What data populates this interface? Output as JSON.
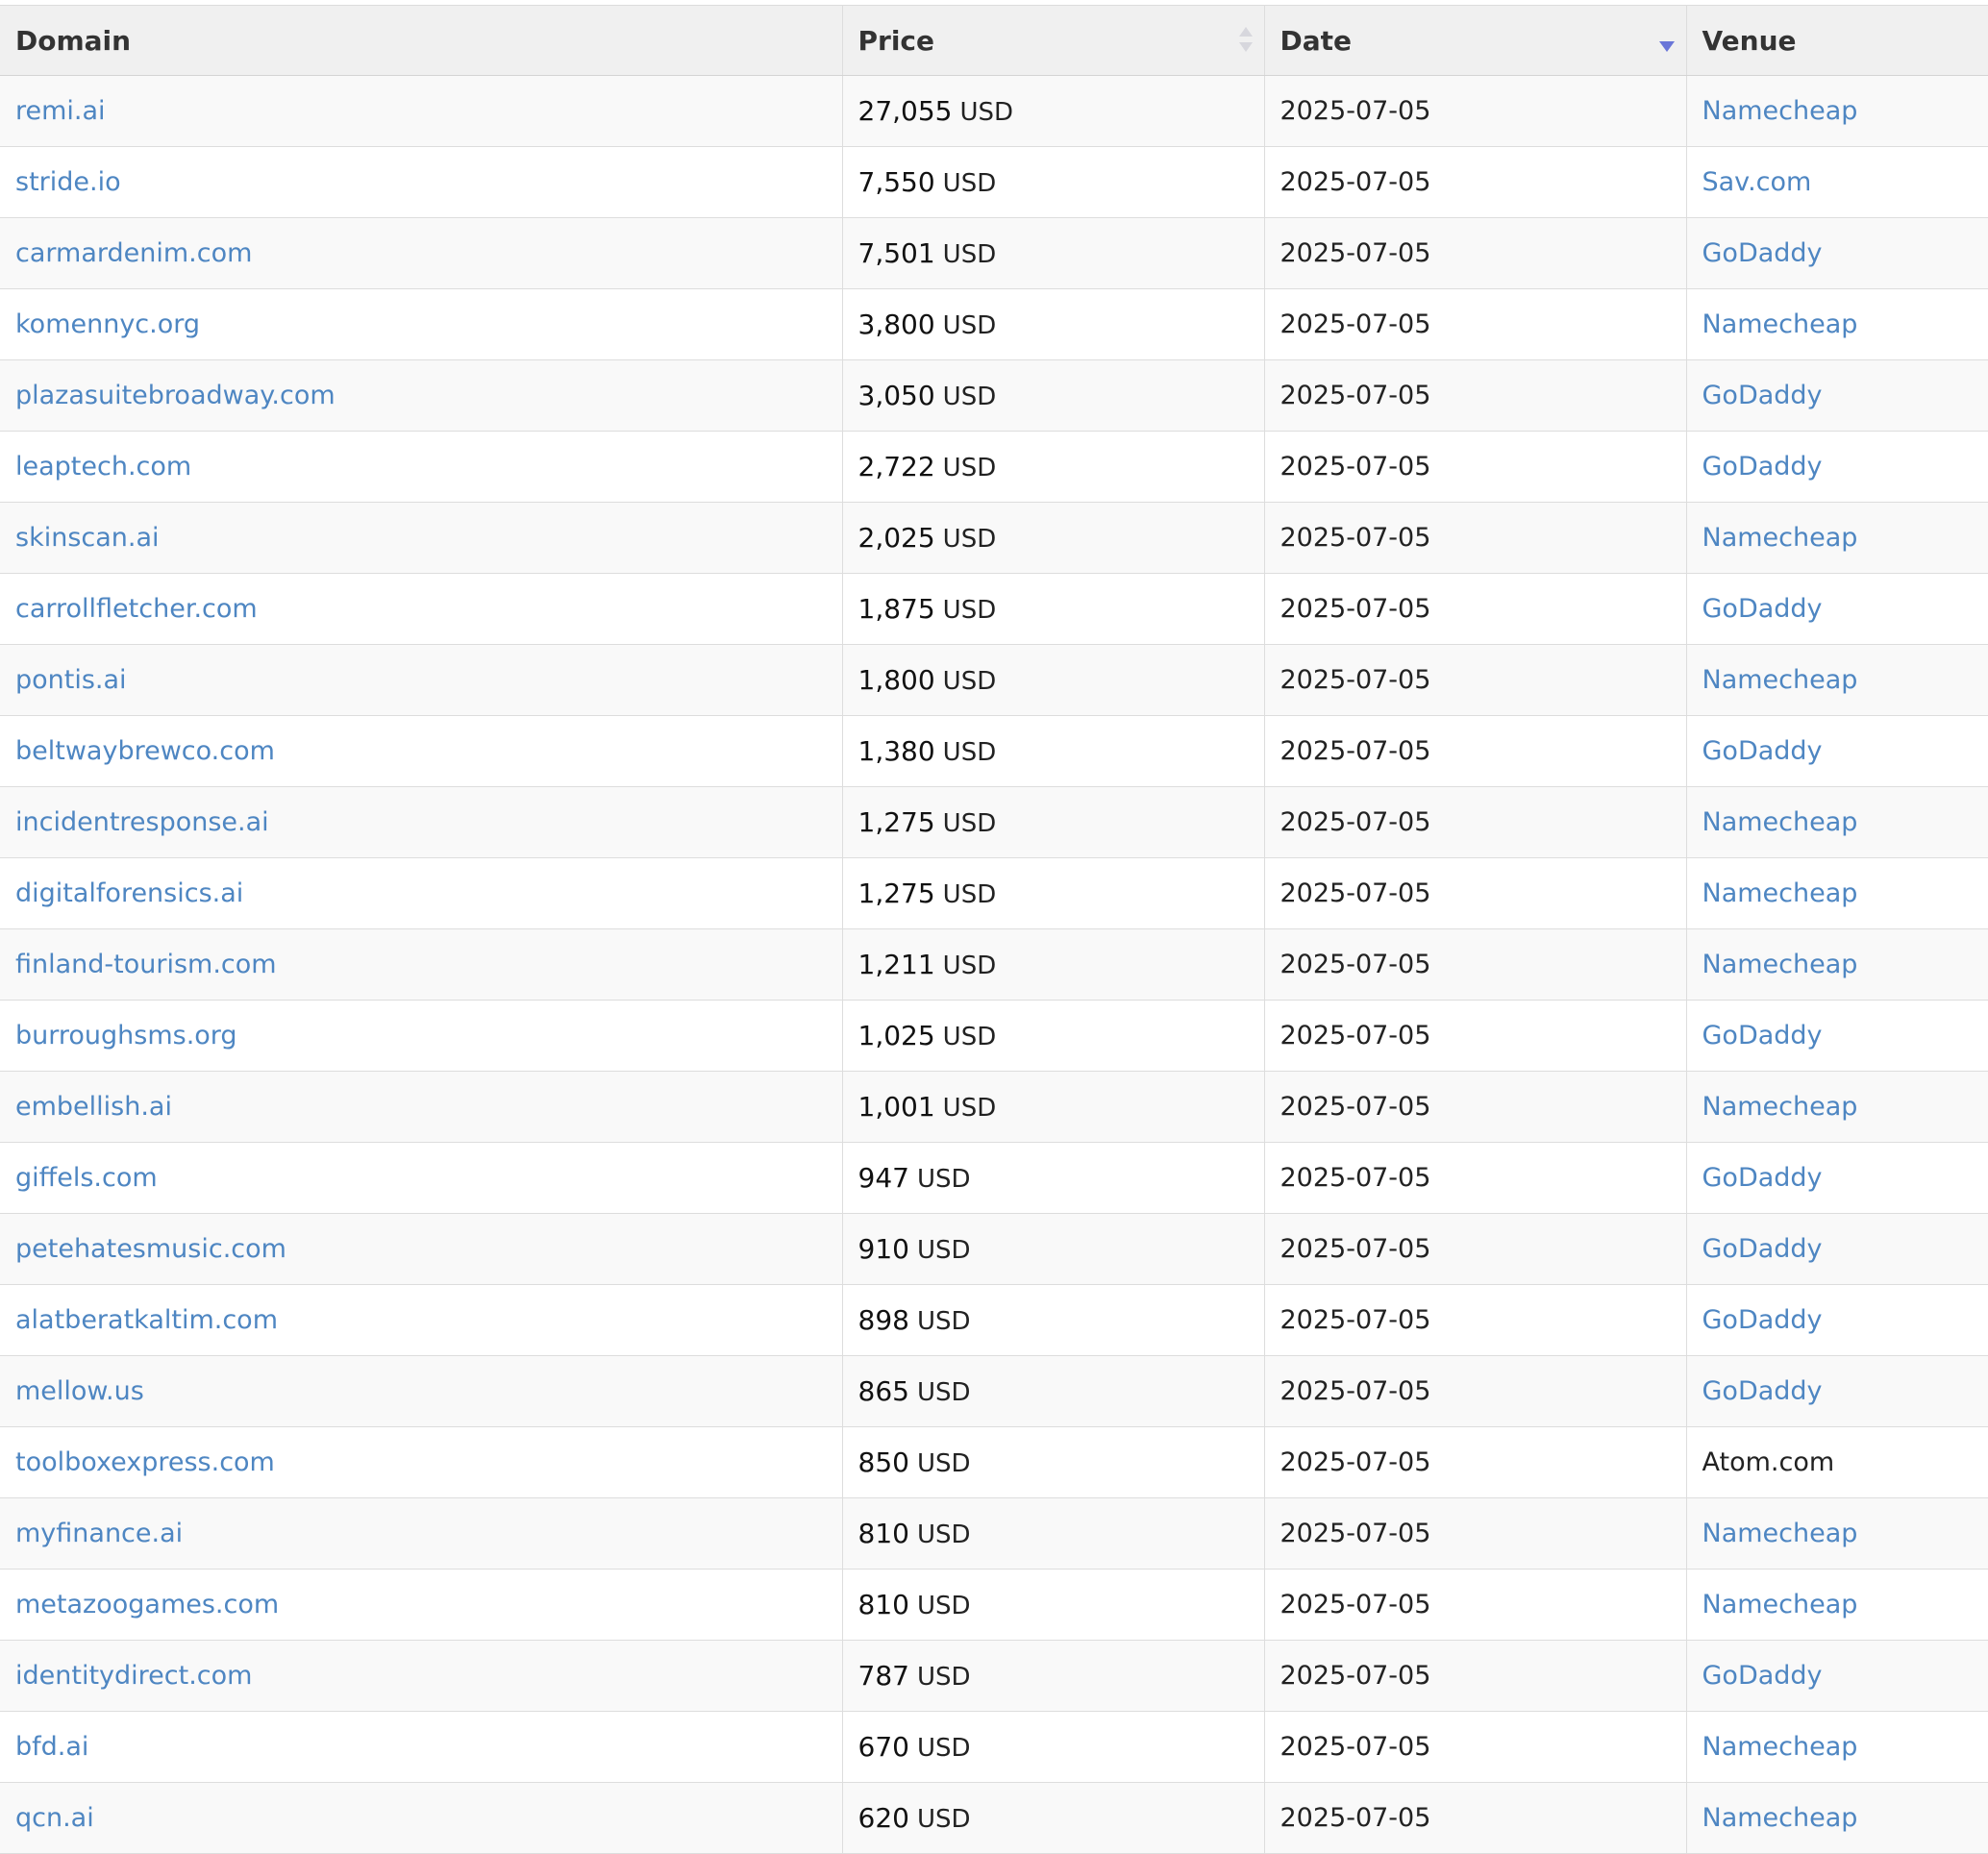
{
  "table": {
    "headers": {
      "domain": "Domain",
      "price": "Price",
      "date": "Date",
      "venue": "Venue"
    },
    "sort": {
      "column": "date",
      "direction": "descending"
    },
    "rows": [
      {
        "domain": "remi.ai",
        "amount": "27,055",
        "currency": "USD",
        "date": "2025-07-05",
        "venue": "Namecheap",
        "venue_link": true
      },
      {
        "domain": "stride.io",
        "amount": "7,550",
        "currency": "USD",
        "date": "2025-07-05",
        "venue": "Sav.com",
        "venue_link": true
      },
      {
        "domain": "carmardenim.com",
        "amount": "7,501",
        "currency": "USD",
        "date": "2025-07-05",
        "venue": "GoDaddy",
        "venue_link": true
      },
      {
        "domain": "komennyc.org",
        "amount": "3,800",
        "currency": "USD",
        "date": "2025-07-05",
        "venue": "Namecheap",
        "venue_link": true
      },
      {
        "domain": "plazasuitebroadway.com",
        "amount": "3,050",
        "currency": "USD",
        "date": "2025-07-05",
        "venue": "GoDaddy",
        "venue_link": true
      },
      {
        "domain": "leaptech.com",
        "amount": "2,722",
        "currency": "USD",
        "date": "2025-07-05",
        "venue": "GoDaddy",
        "venue_link": true
      },
      {
        "domain": "skinscan.ai",
        "amount": "2,025",
        "currency": "USD",
        "date": "2025-07-05",
        "venue": "Namecheap",
        "venue_link": true
      },
      {
        "domain": "carrollfletcher.com",
        "amount": "1,875",
        "currency": "USD",
        "date": "2025-07-05",
        "venue": "GoDaddy",
        "venue_link": true
      },
      {
        "domain": "pontis.ai",
        "amount": "1,800",
        "currency": "USD",
        "date": "2025-07-05",
        "venue": "Namecheap",
        "venue_link": true
      },
      {
        "domain": "beltwaybrewco.com",
        "amount": "1,380",
        "currency": "USD",
        "date": "2025-07-05",
        "venue": "GoDaddy",
        "venue_link": true
      },
      {
        "domain": "incidentresponse.ai",
        "amount": "1,275",
        "currency": "USD",
        "date": "2025-07-05",
        "venue": "Namecheap",
        "venue_link": true
      },
      {
        "domain": "digitalforensics.ai",
        "amount": "1,275",
        "currency": "USD",
        "date": "2025-07-05",
        "venue": "Namecheap",
        "venue_link": true
      },
      {
        "domain": "finland-tourism.com",
        "amount": "1,211",
        "currency": "USD",
        "date": "2025-07-05",
        "venue": "Namecheap",
        "venue_link": true
      },
      {
        "domain": "burroughsms.org",
        "amount": "1,025",
        "currency": "USD",
        "date": "2025-07-05",
        "venue": "GoDaddy",
        "venue_link": true
      },
      {
        "domain": "embellish.ai",
        "amount": "1,001",
        "currency": "USD",
        "date": "2025-07-05",
        "venue": "Namecheap",
        "venue_link": true
      },
      {
        "domain": "giffels.com",
        "amount": "947",
        "currency": "USD",
        "date": "2025-07-05",
        "venue": "GoDaddy",
        "venue_link": true
      },
      {
        "domain": "petehatesmusic.com",
        "amount": "910",
        "currency": "USD",
        "date": "2025-07-05",
        "venue": "GoDaddy",
        "venue_link": true
      },
      {
        "domain": "alatberatkaltim.com",
        "amount": "898",
        "currency": "USD",
        "date": "2025-07-05",
        "venue": "GoDaddy",
        "venue_link": true
      },
      {
        "domain": "mellow.us",
        "amount": "865",
        "currency": "USD",
        "date": "2025-07-05",
        "venue": "GoDaddy",
        "venue_link": true
      },
      {
        "domain": "toolboxexpress.com",
        "amount": "850",
        "currency": "USD",
        "date": "2025-07-05",
        "venue": "Atom.com",
        "venue_link": false
      },
      {
        "domain": "myfinance.ai",
        "amount": "810",
        "currency": "USD",
        "date": "2025-07-05",
        "venue": "Namecheap",
        "venue_link": true
      },
      {
        "domain": "metazoogames.com",
        "amount": "810",
        "currency": "USD",
        "date": "2025-07-05",
        "venue": "Namecheap",
        "venue_link": true
      },
      {
        "domain": "identitydirect.com",
        "amount": "787",
        "currency": "USD",
        "date": "2025-07-05",
        "venue": "GoDaddy",
        "venue_link": true
      },
      {
        "domain": "bfd.ai",
        "amount": "670",
        "currency": "USD",
        "date": "2025-07-05",
        "venue": "Namecheap",
        "venue_link": true
      },
      {
        "domain": "qcn.ai",
        "amount": "620",
        "currency": "USD",
        "date": "2025-07-05",
        "venue": "Namecheap",
        "venue_link": true
      }
    ]
  },
  "colors": {
    "link": "#4e86c2",
    "header_bg": "#f0f0f0",
    "row_alt_bg": "#f9f9f9",
    "sort_active": "#6a76d8",
    "sort_inactive": "#d7d7dd"
  }
}
